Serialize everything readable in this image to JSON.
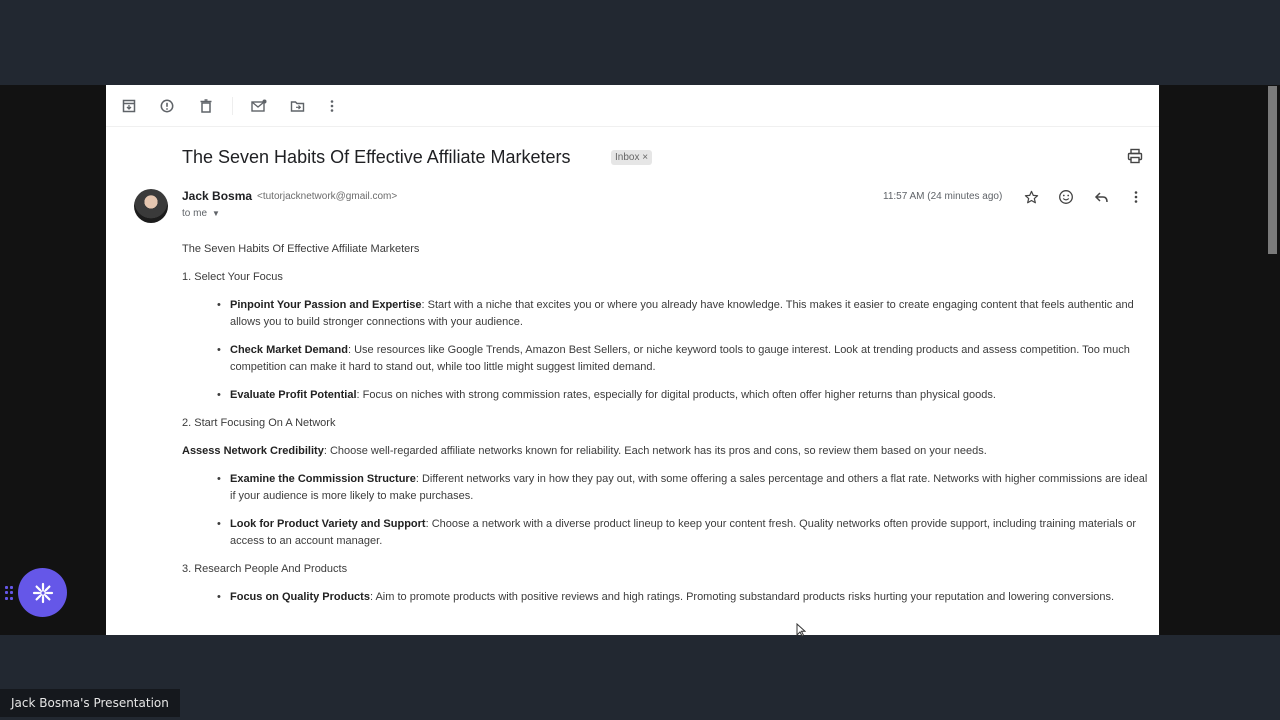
{
  "toolbar": {
    "icons": [
      "archive-icon",
      "report-spam-icon",
      "delete-icon",
      "mark-unread-icon",
      "move-to-icon",
      "more-icon"
    ]
  },
  "email": {
    "subject": "The Seven Habits Of Effective Affiliate Marketers",
    "label": "Inbox",
    "label_close": "×",
    "sender_name": "Jack Bosma",
    "sender_email": "<tutorjacknetwork@gmail.com>",
    "recipient": "to me",
    "timestamp": "11:57 AM (24 minutes ago)"
  },
  "body": {
    "intro": "The Seven Habits Of Effective Affiliate Marketers",
    "sections": [
      {
        "heading": "1. Select Your Focus",
        "items": [
          {
            "bold": "Pinpoint Your Passion and Expertise",
            "text": ": Start with a niche that excites you or where you already have knowledge. This makes it easier to create engaging content that feels authentic and allows you to build stronger connections with your audience."
          },
          {
            "bold": "Check Market Demand",
            "text": ": Use resources like Google Trends, Amazon Best Sellers, or niche keyword tools to gauge interest. Look at trending products and assess competition. Too much competition can make it hard to stand out, while too little might suggest limited demand."
          },
          {
            "bold": "Evaluate Profit Potential",
            "text": ": Focus on niches with strong commission rates, especially for digital products, which often offer higher returns than physical goods."
          }
        ]
      },
      {
        "heading": "2. Start Focusing On A Network",
        "lead_bold": "Assess Network Credibility",
        "lead_text": ": Choose well-regarded affiliate networks known for reliability. Each network has its pros and cons, so review them based on your needs.",
        "items": [
          {
            "bold": "Examine the Commission Structure",
            "text": ": Different networks vary in how they pay out, with some offering a sales percentage and others a flat rate. Networks with higher commissions are ideal if your audience is more likely to make purchases."
          },
          {
            "bold": "Look for Product Variety and Support",
            "text": ": Choose a network with a diverse product lineup to keep your content fresh. Quality networks often provide support, including training materials or access to an account manager."
          }
        ]
      },
      {
        "heading": "3. Research People And Products",
        "items": [
          {
            "bold": "Focus on Quality Products",
            "text": ": Aim to promote products with positive reviews and high ratings. Promoting substandard products risks hurting your reputation and lowering conversions."
          }
        ]
      }
    ]
  },
  "overlay": {
    "presenter_label": "Jack Bosma's Presentation",
    "accent_color": "#6557e8"
  }
}
